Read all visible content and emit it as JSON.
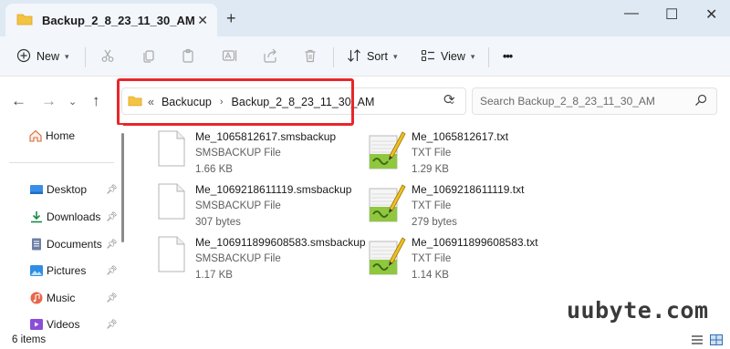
{
  "window": {
    "tab_title": "Backup_2_8_23_11_30_AM",
    "tab_close": "✕",
    "new_tab": "+",
    "minimize": "—",
    "maximize": "☐",
    "close": "✕"
  },
  "toolbar": {
    "new_label": "New",
    "sort_label": "Sort",
    "view_label": "View",
    "more_label": "•••"
  },
  "address": {
    "overflow": "«",
    "crumbs": [
      "Backucup",
      "Backup_2_8_23_11_30_AM"
    ],
    "search_placeholder": "Search Backup_2_8_23_11_30_AM"
  },
  "sidebar": {
    "items": [
      {
        "label": "Home",
        "icon": "home-icon"
      },
      {
        "label": "Desktop",
        "icon": "desktop-icon",
        "pinned": true
      },
      {
        "label": "Downloads",
        "icon": "downloads-icon",
        "pinned": true
      },
      {
        "label": "Documents",
        "icon": "documents-icon",
        "pinned": true
      },
      {
        "label": "Pictures",
        "icon": "pictures-icon",
        "pinned": true
      },
      {
        "label": "Music",
        "icon": "music-icon",
        "pinned": true
      },
      {
        "label": "Videos",
        "icon": "videos-icon",
        "pinned": true
      }
    ]
  },
  "files": [
    {
      "name": "Me_1065812617.smsbackup",
      "type": "SMSBACKUP File",
      "size": "1.66 KB"
    },
    {
      "name": "Me_1065812617.txt",
      "type": "TXT File",
      "size": "1.29 KB"
    },
    {
      "name": "Me_1069218611119.smsbackup",
      "type": "SMSBACKUP File",
      "size": "307 bytes"
    },
    {
      "name": "Me_1069218611119.txt",
      "type": "TXT File",
      "size": "279 bytes"
    },
    {
      "name": "Me_106911899608583.smsbackup",
      "type": "SMSBACKUP File",
      "size": "1.17 KB"
    },
    {
      "name": "Me_106911899608583.txt",
      "type": "TXT File",
      "size": "1.14 KB"
    }
  ],
  "status": {
    "item_count": "6 items"
  },
  "watermark": "uubyte.com",
  "colors": {
    "highlight": "#e8262a",
    "folder": "#f5c342",
    "titlebar": "#dfe9f4"
  }
}
